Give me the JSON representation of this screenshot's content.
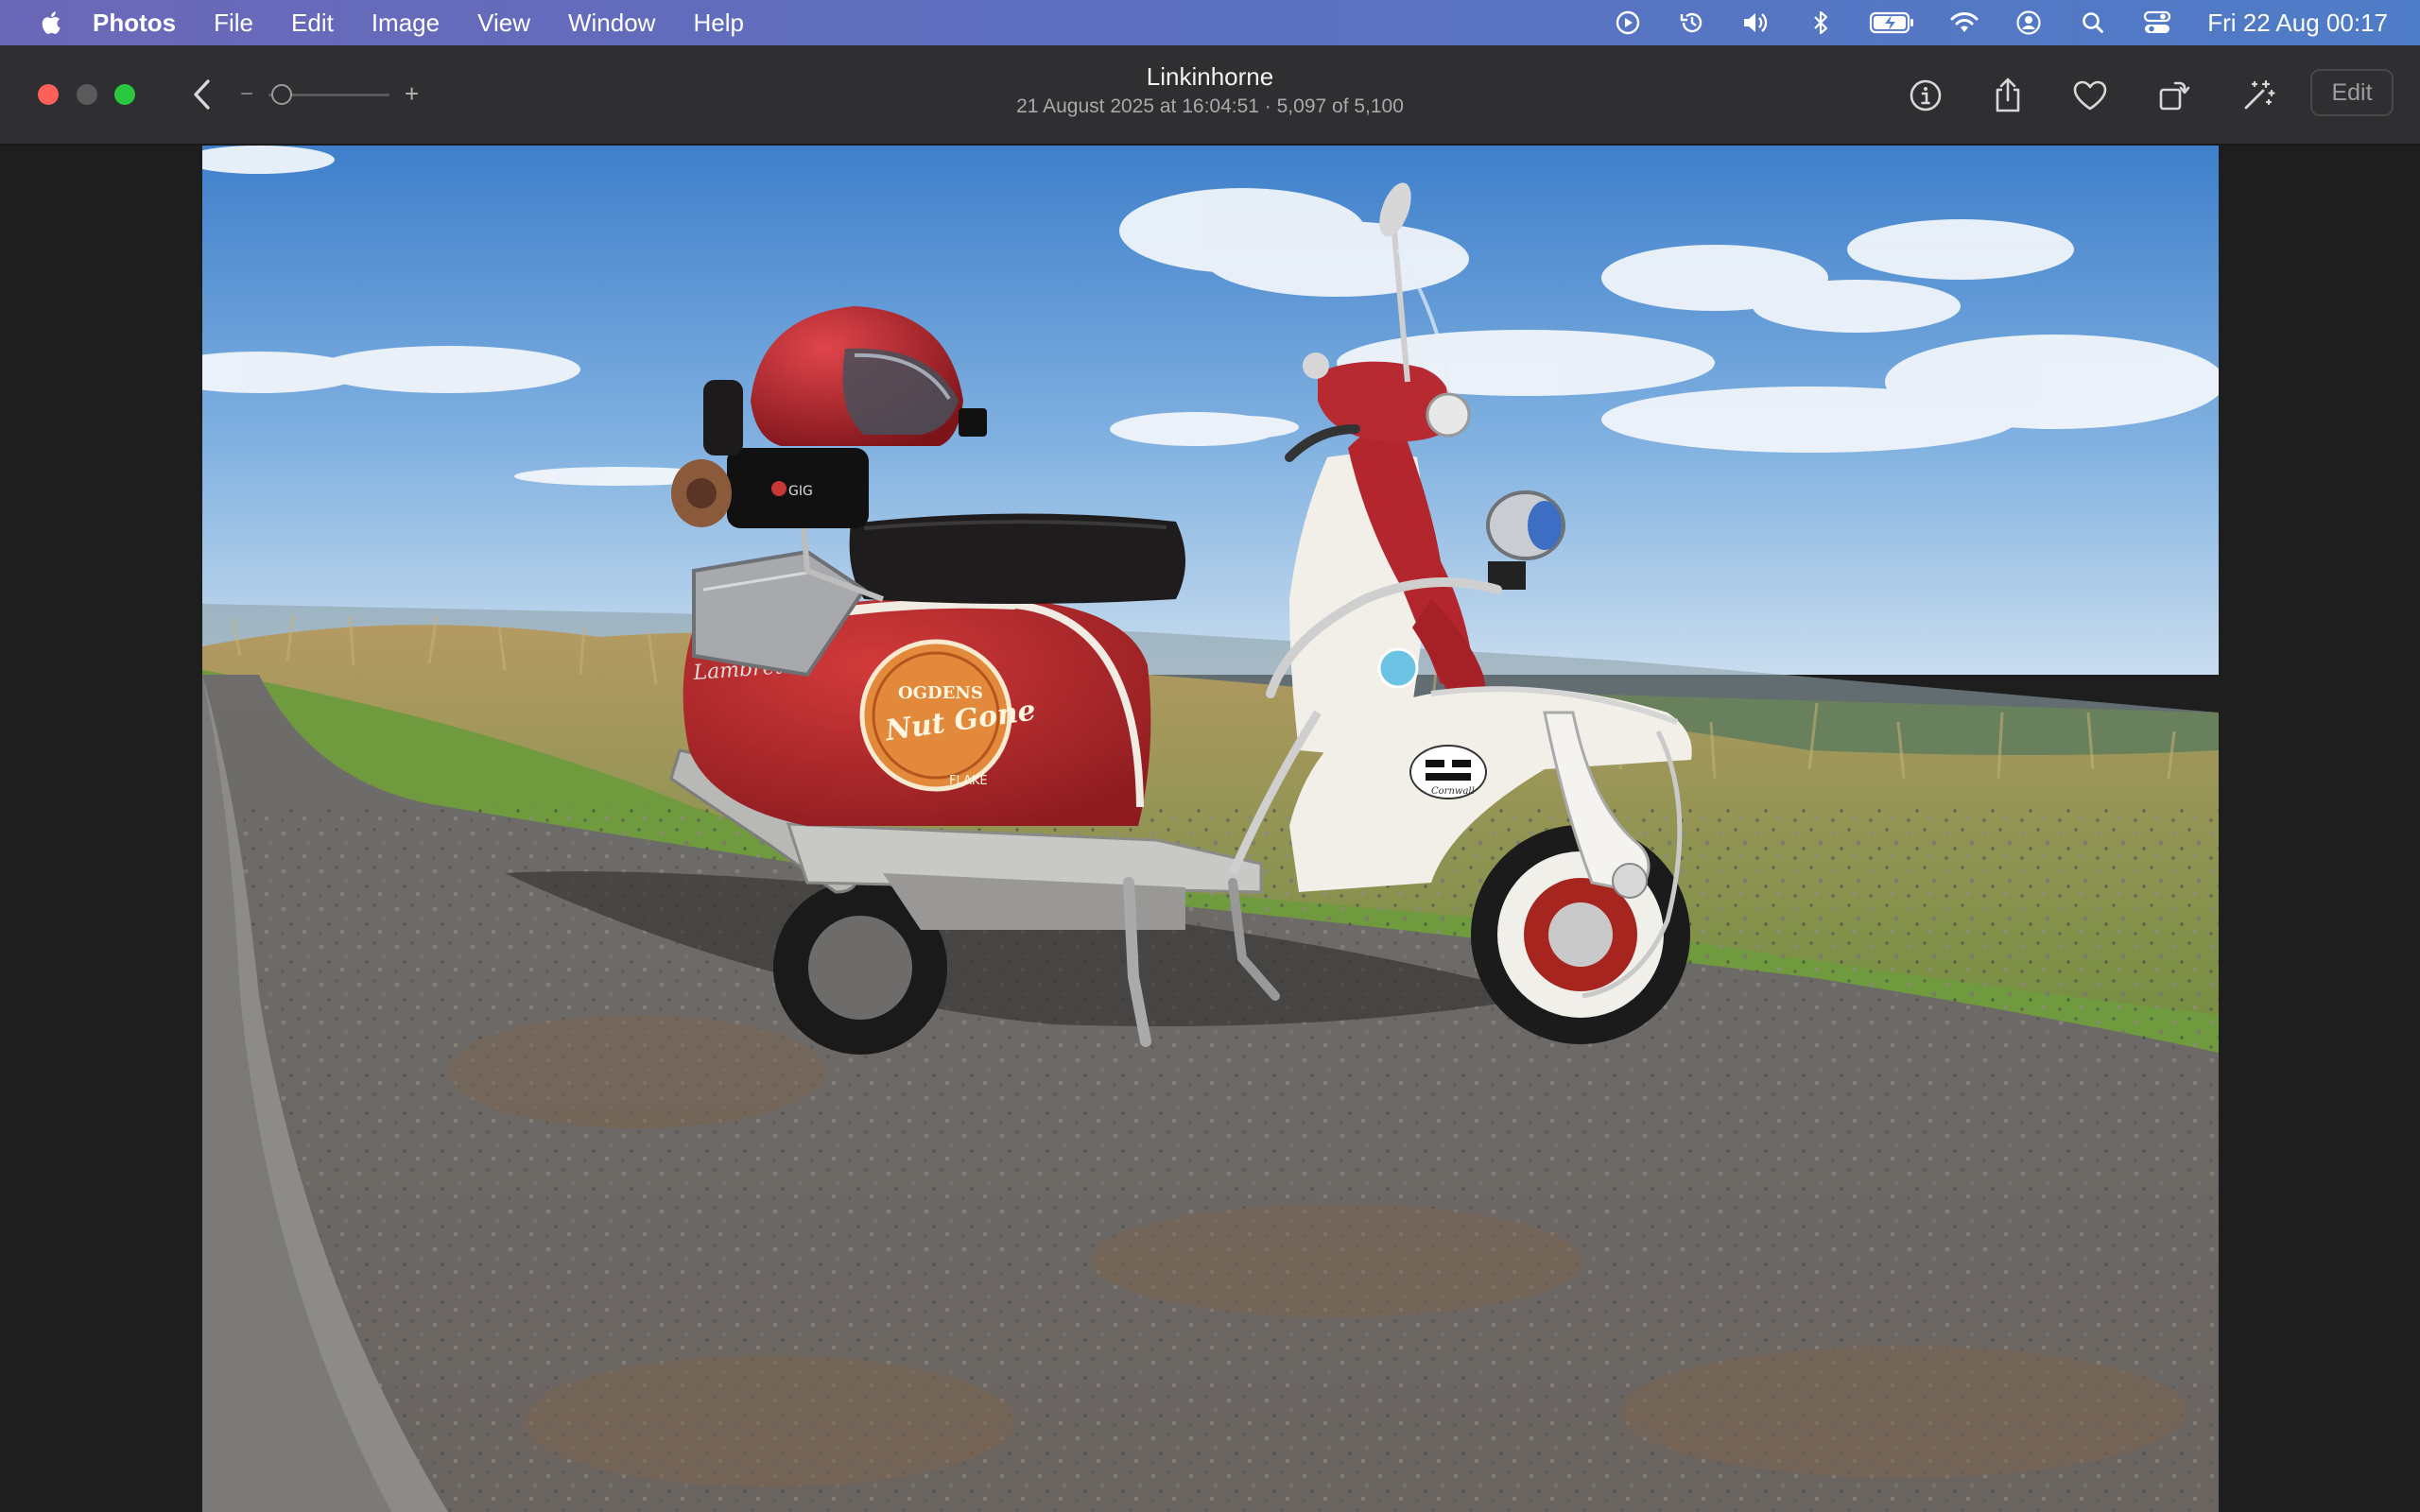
{
  "menubar": {
    "app_name": "Photos",
    "menus": [
      "File",
      "Edit",
      "Image",
      "View",
      "Window",
      "Help"
    ],
    "clock": "Fri 22 Aug  00:17",
    "status_icons": [
      "play-icon",
      "time-machine-icon",
      "volume-icon",
      "bluetooth-icon",
      "battery-icon",
      "wifi-icon",
      "user-icon",
      "search-icon",
      "control-center-icon"
    ]
  },
  "toolbar": {
    "title": "Linkinhorne",
    "subtitle": "21 August 2025 at 16:04:51  ·  5,097 of 5,100",
    "zoom_minus": "−",
    "zoom_plus": "+",
    "zoom_level": 0.03,
    "edit_label": "Edit"
  },
  "photo": {
    "sticker_text_1": "OGDENS",
    "sticker_text_2": "Nut Gone",
    "sticker_text_3": "FLAKE",
    "side_badge": "Cornwall"
  },
  "colors": {
    "menubar_left": "#6b67b8",
    "menubar_right": "#4f7cc7",
    "toolbar": "#2f2f31",
    "close": "#fe5f57",
    "zoom": "#29c840"
  }
}
